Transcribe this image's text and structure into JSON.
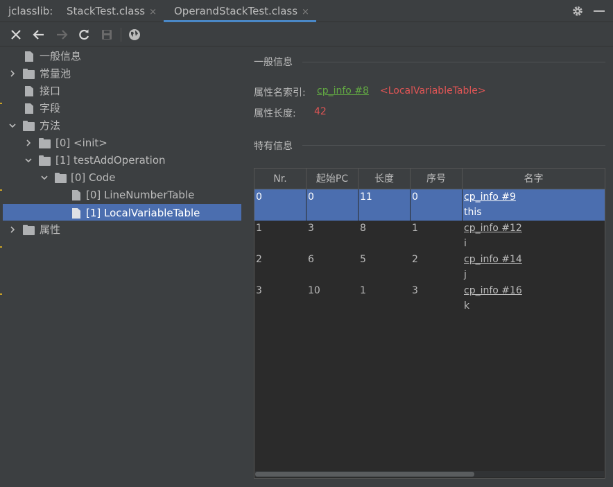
{
  "app_label": "jclasslib:",
  "tabs": [
    {
      "label": "StackTest.class",
      "active": false
    },
    {
      "label": "OperandStackTest.class",
      "active": true
    }
  ],
  "tab_close_glyph": "×",
  "toolbar_icons": [
    "close-icon",
    "back-icon",
    "forward-icon",
    "refresh-icon",
    "save-icon",
    "browser-icon"
  ],
  "tree": [
    {
      "label": "一般信息",
      "type": "file"
    },
    {
      "label": "常量池",
      "type": "folder",
      "expanded": false
    },
    {
      "label": "接口",
      "type": "file"
    },
    {
      "label": "字段",
      "type": "file"
    },
    {
      "label": "方法",
      "type": "folder",
      "expanded": true
    },
    {
      "label": "[0] <init>",
      "type": "folder",
      "expanded": false
    },
    {
      "label": "[1] testAddOperation",
      "type": "folder",
      "expanded": true
    },
    {
      "label": "[0] Code",
      "type": "folder",
      "expanded": true
    },
    {
      "label": "[0] LineNumberTable",
      "type": "file"
    },
    {
      "label": "[1] LocalVariableTable",
      "type": "file",
      "selected": true
    },
    {
      "label": "属性",
      "type": "folder",
      "expanded": false
    }
  ],
  "general": {
    "title": "一般信息",
    "name_index_label": "属性名索引:",
    "name_index_link": "cp_info #8",
    "name_index_value": "<LocalVariableTable>",
    "length_label": "属性长度:",
    "length_value": "42"
  },
  "specific": {
    "title": "特有信息"
  },
  "table": {
    "columns": [
      "Nr.",
      "起始PC",
      "长度",
      "序号",
      "名字"
    ],
    "rows": [
      {
        "nr": "0",
        "start_pc": "0",
        "length": "11",
        "index": "0",
        "name_link": "cp_info #9",
        "name": "this",
        "selected": true
      },
      {
        "nr": "1",
        "start_pc": "3",
        "length": "8",
        "index": "1",
        "name_link": "cp_info #12",
        "name": "i"
      },
      {
        "nr": "2",
        "start_pc": "6",
        "length": "5",
        "index": "2",
        "name_link": "cp_info #14",
        "name": "j"
      },
      {
        "nr": "3",
        "start_pc": "10",
        "length": "1",
        "index": "3",
        "name_link": "cp_info #16",
        "name": "k"
      }
    ]
  },
  "colors": {
    "background": "#3c3f41",
    "selection": "#4b6eaf",
    "link": "#62a942",
    "value_red": "#e05555",
    "active_tab_underline": "#4a88c7"
  }
}
